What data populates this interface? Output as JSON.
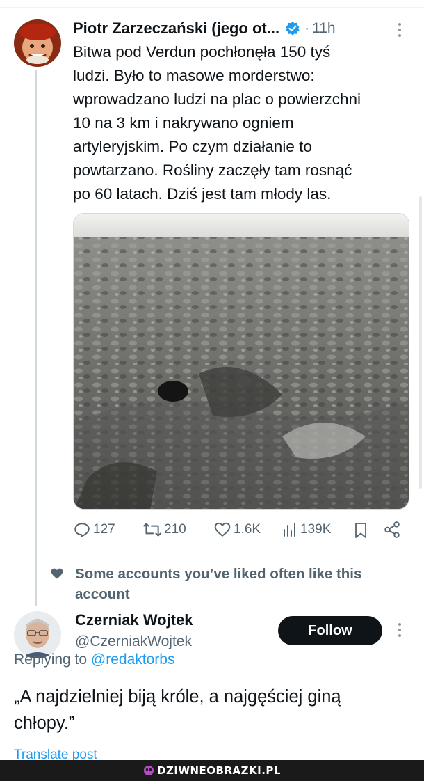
{
  "tweet1": {
    "author_name": "Piotr Zarzeczański (jego ot...",
    "separator": "·",
    "time": "11h",
    "text": "Bitwa pod Verdun pochłonęła 150 tyś\nludzi. Było to masowe morderstwo:\nwprowadzano ludzi na plac o powierzchni\n10 na 3 km i nakrywano ogniem\nartyleryjskim. Po czym działanie to\npowtarzano.  Rośliny zaczęły tam rosnąć\npo 60 latach. Dziś jest tam młody las.",
    "media_icon": "battlefield-photo",
    "stats": {
      "replies": "127",
      "reposts": "210",
      "likes": "1.6K",
      "views": "139K"
    }
  },
  "social_context": {
    "icon": "heart-icon",
    "text": "Some accounts you’ve liked often like this account"
  },
  "tweet2": {
    "author_name": "Czerniak Wojtek",
    "handle": "@CzerniakWojtek",
    "follow_label": "Follow",
    "replying_prefix": "Replying to ",
    "replying_to": "@redaktorbs",
    "text": "„A najdzielniej biją króle, a najgęściej giną chłopy.”",
    "translate_label": "Translate post"
  },
  "watermark": {
    "text": "DZIWNEOBRAZKI.PL"
  },
  "colors": {
    "text_primary": "#0f1419",
    "text_secondary": "#536471",
    "accent": "#1d9bf0",
    "verified": "#1d9bf0"
  }
}
